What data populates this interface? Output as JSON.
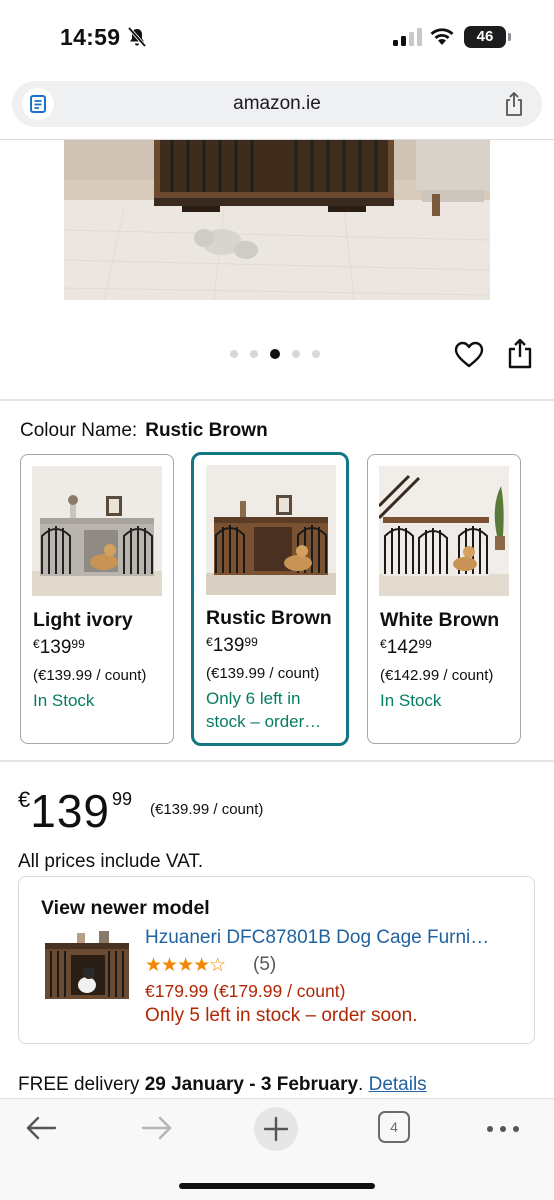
{
  "status_bar": {
    "time": "14:59",
    "battery": "46"
  },
  "browser": {
    "url": "amazon.ie",
    "open_tabs": "4"
  },
  "gallery": {
    "image_count": 5,
    "active_index": 2
  },
  "colour": {
    "label": "Colour Name:",
    "selected": "Rustic Brown",
    "options": [
      {
        "name": "Light ivory",
        "currency": "€",
        "whole": "139",
        "fraction": "99",
        "unit_price": "(€139.99 / count)",
        "stock": "In Stock"
      },
      {
        "name": "Rustic Brown",
        "currency": "€",
        "whole": "139",
        "fraction": "99",
        "unit_price": "(€139.99 / count)",
        "stock": "Only 6 left in stock – order…"
      },
      {
        "name": "White Brown",
        "currency": "€",
        "whole": "142",
        "fraction": "99",
        "unit_price": "(€142.99 / count)",
        "stock": "In Stock"
      }
    ]
  },
  "price": {
    "currency": "€",
    "whole": "139",
    "fraction": "99",
    "unit_price": "(€139.99 / count)",
    "vat_note": "All prices include VAT."
  },
  "newer_model": {
    "heading": "View newer model",
    "title": "Hzuaneri DFC87801B Dog Cage Furni…",
    "stars": "★★★★☆",
    "rating_count": "(5)",
    "price": "€179.99 (€179.99 / count)",
    "stock": "Only 5 left in stock – order soon."
  },
  "delivery": {
    "prefix": "FREE delivery ",
    "dates": "29 January - 3 February",
    "suffix": ". ",
    "link": "Details"
  },
  "colors": {
    "accent_teal": "#127683",
    "link_blue": "#2162a1",
    "stock_green": "#067d62",
    "alert_red": "#b12704",
    "star_orange": "#f08804"
  }
}
